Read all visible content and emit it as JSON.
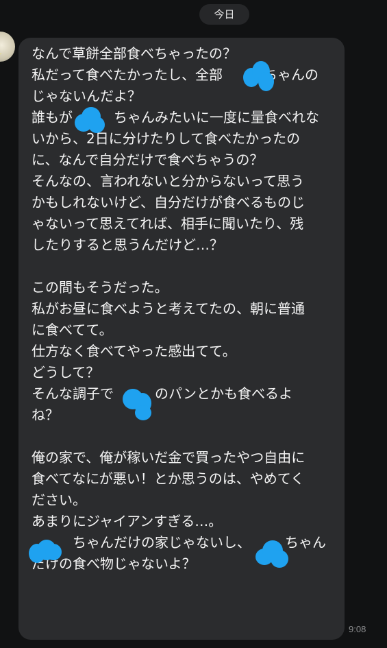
{
  "header": {
    "date_label": "今日"
  },
  "message": {
    "text": "なんで草餅全部食べちゃったの？\n私だって食べたかったし、全部　　　ちゃんの\nじゃないんだよ？\n誰もが　　　ちゃんみたいに一度に量食べれな\nいから、2日に分けたりして食べたかったの\nに、なんで自分だけで食べちゃうの？\nそんなの、言われないと分からないって思う\nかもしれないけど、自分だけが食べるものじ\nゃないって思えてれば、相手に聞いたり、残\nしたりすると思うんだけど…？\n\nこの間もそうだった。\n私がお昼に食べようと考えてたの、朝に普通\nに食べてて。\n仕方なく食べてやった感出てて。\nどうして？\nそんな調子で　　　のパンとかも食べるよ\nね？\n\n俺の家で、俺が稼いだ金で買ったやつ自由に\n食べてなにが悪い！とか思うのは、やめてく\nださい。\nあまりにジャイアンすぎる…。\n　　　ちゃんだけの家じゃないし、　　　ちゃん\nだけの食べ物じゃないよ？",
    "time": "9:08"
  },
  "colors": {
    "background": "#111213",
    "bubble": "#2b2c2e",
    "text": "#f4f4f4",
    "redaction": "#1fa2f0"
  },
  "icons": {
    "avatar": "moon-avatar-icon"
  }
}
